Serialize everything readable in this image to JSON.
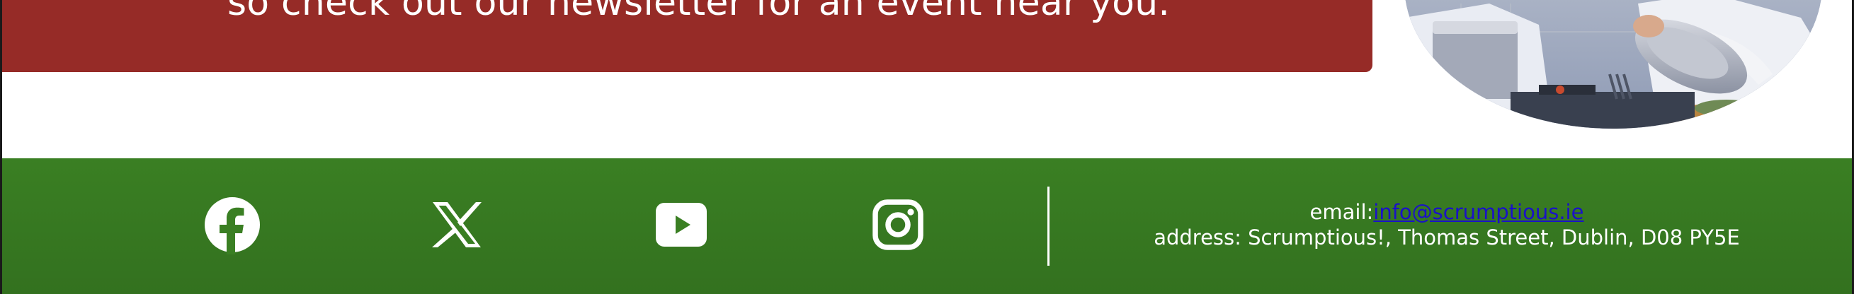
{
  "banner": {
    "text": "so check out our newsletter for an event near you."
  },
  "photo": {
    "subject": "chefs cooking in a professional kitchen"
  },
  "footer": {
    "social": [
      {
        "name": "facebook",
        "icon": "facebook-icon"
      },
      {
        "name": "x",
        "icon": "x-icon"
      },
      {
        "name": "youtube",
        "icon": "youtube-icon"
      },
      {
        "name": "instagram",
        "icon": "instagram-icon"
      }
    ],
    "contact": {
      "email_label": "email:",
      "email": "info@scrumptious.ie",
      "address": "address: Scrumptious!, Thomas Street, Dublin, D08 PY5E"
    }
  },
  "colors": {
    "banner_red": "#962b27",
    "footer_green": "#3a7f23",
    "link_blue": "#1a11c9"
  }
}
